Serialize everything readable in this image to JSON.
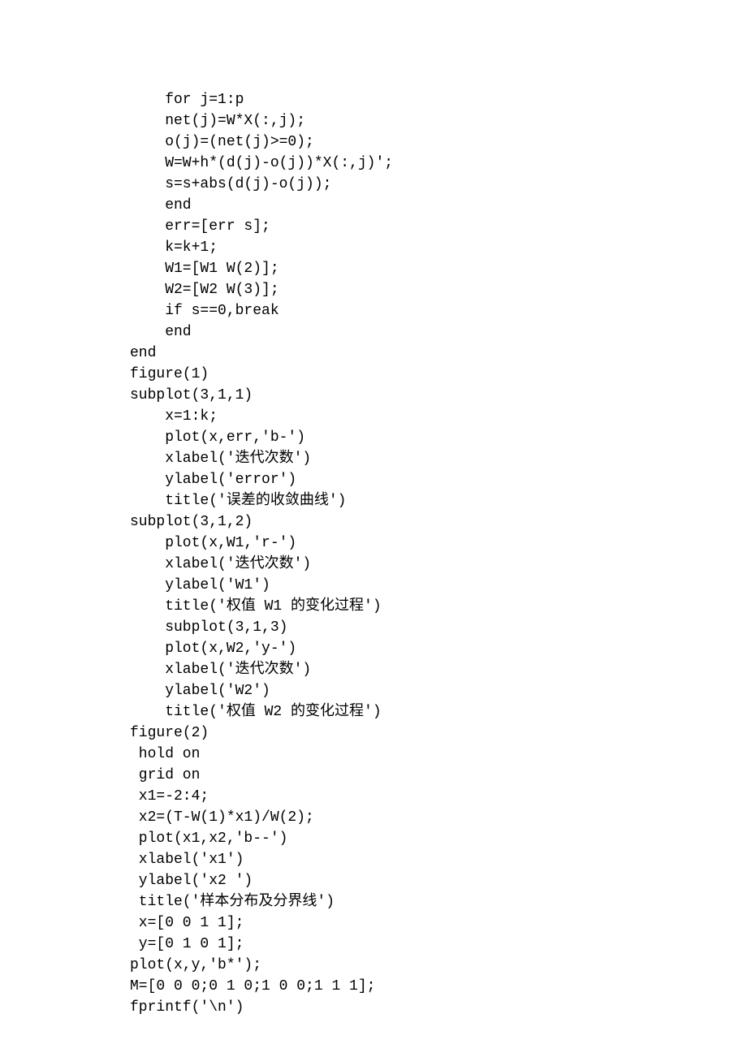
{
  "lines": [
    "    for j=1:p",
    "    net(j)=W*X(:,j);",
    "    o(j)=(net(j)>=0);",
    "    W=W+h*(d(j)-o(j))*X(:,j)';",
    "    s=s+abs(d(j)-o(j));",
    "    end",
    "    err=[err s];",
    "    k=k+1;",
    "    W1=[W1 W(2)];",
    "    W2=[W2 W(3)];",
    "    if s==0,break",
    "    end",
    "end",
    "figure(1)",
    "subplot(3,1,1)",
    "    x=1:k;",
    "    plot(x,err,'b-')",
    "    xlabel('迭代次数')",
    "    ylabel('error')",
    "    title('误差的收敛曲线')",
    "subplot(3,1,2)",
    "    plot(x,W1,'r-')",
    "    xlabel('迭代次数')",
    "    ylabel('W1')",
    "    title('权值 W1 的变化过程')",
    "    subplot(3,1,3)",
    "    plot(x,W2,'y-')",
    "    xlabel('迭代次数')",
    "    ylabel('W2')",
    "    title('权值 W2 的变化过程')",
    "figure(2)",
    " hold on",
    " grid on",
    " x1=-2:4;",
    " x2=(T-W(1)*x1)/W(2);",
    " plot(x1,x2,'b--')",
    " xlabel('x1')",
    " ylabel('x2 ')",
    " title('样本分布及分界线')",
    " x=[0 0 1 1];",
    " y=[0 1 0 1];",
    "plot(x,y,'b*');",
    "M=[0 0 0;0 1 0;1 0 0;1 1 1];",
    "fprintf('\\n')"
  ]
}
